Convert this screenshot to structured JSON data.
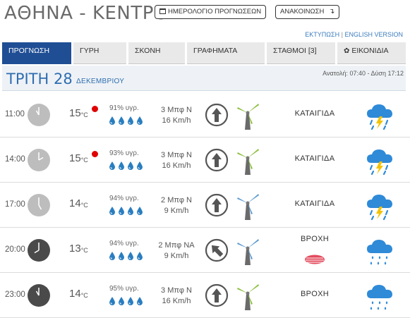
{
  "header": {
    "title": "ΑΘΗΝΑ - ΚΕΝΤΡΟ",
    "calendar_button": "ΗΜΕΡΟΛΟΓΙΟ ΠΡΟΓΝΩΣΕΩΝ",
    "announcement_button": "ΑΝΑΚΟΙΝΩΣΗ",
    "print_link": "ΕΚΤΥΠΩΣΗ",
    "link_separator": "|",
    "english_link": "ENGLISH VERSION"
  },
  "tabs": [
    {
      "label": "ΠΡΟΓΝΩΣΗ",
      "active": true
    },
    {
      "label": "ΓΥΡΗ"
    },
    {
      "label": "ΣΚΟΝΗ"
    },
    {
      "label": "ΓΡΑΦΗΜΑΤΑ"
    },
    {
      "label": "ΣΤΑΘΜΟΙ [3]"
    },
    {
      "label": "ΕΙΚΟΝΙΔΙΑ"
    }
  ],
  "day": {
    "title": "ΤΡΙΤΗ 28",
    "month": "ΔΕΚΕΜΒΡΙΟΥ",
    "sun": "Ανατολή: 07:40 - Δύση 17:12"
  },
  "rows": [
    {
      "time": "11:00",
      "hour": 11,
      "night": false,
      "temp": "15",
      "unit": "°C",
      "red_dot": true,
      "humidity": "91% υγρ.",
      "wind_bf": "3 Μπφ Ν",
      "wind_kmh": "16 Km/h",
      "arrow_deg": 0,
      "turbine": "green",
      "condition": "ΚΑΤΑΙΓΙΔΑ",
      "icon": "thunderstorm-icon"
    },
    {
      "time": "14:00",
      "hour": 14,
      "night": false,
      "temp": "15",
      "unit": "°C",
      "red_dot": true,
      "humidity": "93% υγρ.",
      "wind_bf": "3 Μπφ Ν",
      "wind_kmh": "16 Km/h",
      "arrow_deg": 0,
      "turbine": "green",
      "condition": "ΚΑΤΑΙΓΙΔΑ",
      "icon": "thunderstorm-icon"
    },
    {
      "time": "17:00",
      "hour": 17,
      "night": false,
      "temp": "14",
      "unit": "°C",
      "red_dot": false,
      "humidity": "94% υγρ.",
      "wind_bf": "2 Μπφ Ν",
      "wind_kmh": "9 Km/h",
      "arrow_deg": 0,
      "turbine": "blue",
      "condition": "ΚΑΤΑΙΓΙΔΑ",
      "icon": "thunderstorm-icon"
    },
    {
      "time": "20:00",
      "hour": 20,
      "night": true,
      "temp": "13",
      "unit": "°C",
      "red_dot": false,
      "humidity": "94% υγρ.",
      "wind_bf": "2 Μπφ ΝΑ",
      "wind_kmh": "9 Km/h",
      "arrow_deg": -45,
      "turbine": "blue",
      "condition": "ΒΡΟΧΗ",
      "icon": "rain-icon",
      "fog": true
    },
    {
      "time": "23:00",
      "hour": 23,
      "night": true,
      "temp": "14",
      "unit": "°C",
      "red_dot": false,
      "humidity": "95% υγρ.",
      "wind_bf": "3 Μπφ Ν",
      "wind_kmh": "16 Km/h",
      "arrow_deg": 0,
      "turbine": "green",
      "condition": "ΒΡΟΧΗ",
      "icon": "rain-icon"
    }
  ],
  "colors": {
    "tab_active": "#1f4e95",
    "accent_blue": "#2f6db0",
    "drop_blue": "#2a7ec0",
    "cloud_blue": "#2f8ad8",
    "bolt": "#f2c200",
    "red": "#e00000"
  }
}
